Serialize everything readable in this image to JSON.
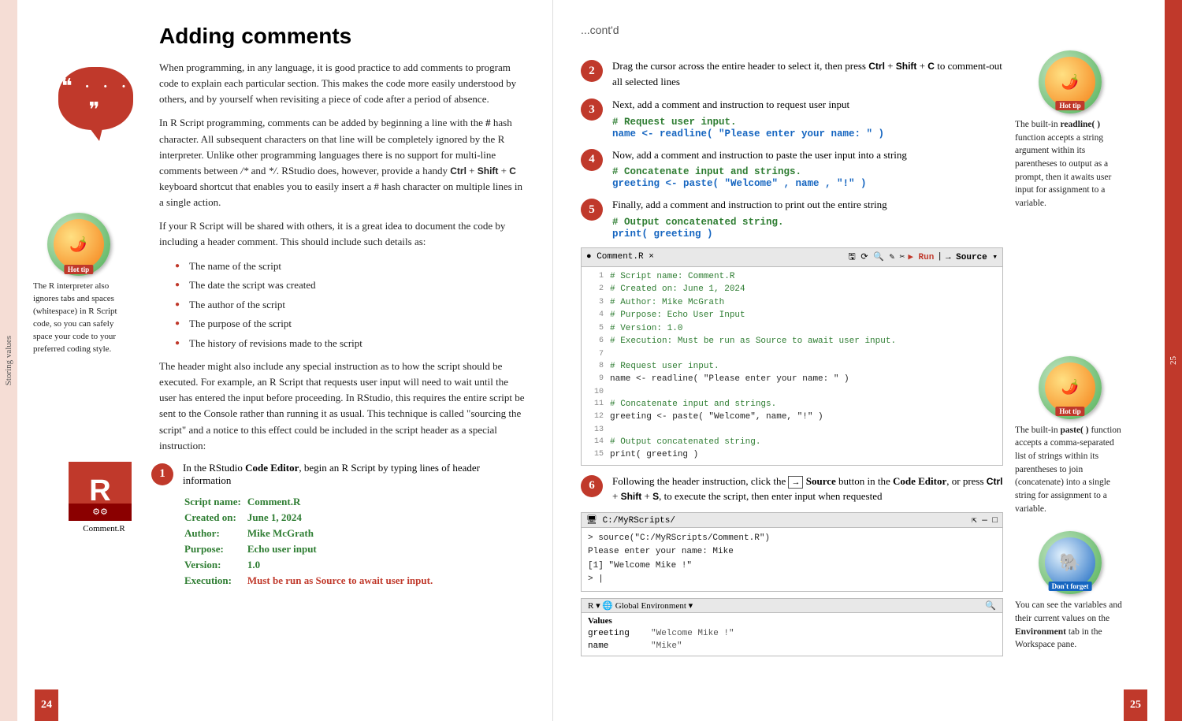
{
  "left_tab": {
    "label": "Storing values"
  },
  "right_tab": {
    "label": "25"
  },
  "page_number_left": "24",
  "page_number_right": "25",
  "left_page": {
    "title": "Adding comments",
    "paragraphs": [
      "When programming, in any language, it is good practice to add comments to program code to explain each particular section. This makes the code more easily understood by others, and by yourself when revisiting a piece of code after a period of absence.",
      "In R Script programming, comments can be added by beginning a line with the # hash character. All subsequent characters on that line will be completely ignored by the R interpreter. Unlike other programming languages there is no support for multi-line comments between /* and */. RStudio does, however, provide a handy Ctrl + Shift + C keyboard shortcut that enables you to easily insert a # hash character on multiple lines in a single action.",
      "If your R Script will be shared with others, it is a great idea to document the code by including a header comment. This should include such details as:"
    ],
    "bullet_items": [
      "The name of the script",
      "The date the script was created",
      "The author of the script",
      "The purpose of the script",
      "The history of revisions made to the script"
    ],
    "paragraph_after_bullets": "The header might also include any special instruction as to how the script should be executed. For example, an R Script that requests user input will need to wait until the user has entered the input before proceeding. In RStudio, this requires the entire script be sent to the Console rather than running it as usual. This technique is called \"sourcing the script\" and a notice to this effect could be included in the script header as a special instruction:",
    "hot_tip_top": {
      "text": "The R interpreter also ignores tabs and spaces (whitespace) in R Script code, so you can safely space your code to your preferred coding style."
    },
    "step1": {
      "number": "1",
      "intro": "In the RStudio Code Editor, begin an R Script by typing lines of header information",
      "script_name_label": "Script name:",
      "script_name_value": "Comment.R",
      "created_label": "Created on:",
      "created_value": "June 1, 2024",
      "author_label": "Author:",
      "author_value": "Mike McGrath",
      "purpose_label": "Purpose:",
      "purpose_value": "Echo user input",
      "version_label": "Version:",
      "version_value": "1.0",
      "execution_label": "Execution:",
      "execution_value": "Must be run as Source to await user input.",
      "r_icon_label": "Comment.R"
    }
  },
  "right_page": {
    "cont_label": "...cont'd",
    "hot_tip1": {
      "label": "Hot tip",
      "text1": "The built-in",
      "bold1": "readline( )",
      "text2": "function accepts a string argument within its parentheses to output as a prompt, then it awaits user input for assignment to a variable."
    },
    "hot_tip2": {
      "label": "Hot tip",
      "text1": "The built-in",
      "bold1": "paste( )",
      "text2": "function accepts a comma-separated list of strings within its parentheses to join (concatenate) into a single string for assignment to a variable."
    },
    "dont_forget": {
      "label": "Don't forget",
      "text": "You can see the variables and their current values on the Environment tab in the Workspace pane."
    },
    "steps": [
      {
        "number": "2",
        "text": "Drag the cursor across the entire header to select it, then press Ctrl + Shift + C to comment-out all selected lines"
      },
      {
        "number": "3",
        "text": "Next, add a comment and instruction to request user input",
        "code_lines": [
          "# Request user input.",
          "name <- readline( \"Please enter your name: \" )"
        ]
      },
      {
        "number": "4",
        "text": "Now, add a comment and instruction to paste the user input into a string",
        "code_lines": [
          "# Concatenate input and strings.",
          "greeting <- paste( \"Welcome\" , name , \"!\" )"
        ]
      },
      {
        "number": "5",
        "text": "Finally, add a comment and instruction to print out the entire string",
        "code_lines": [
          "# Output concatenated string.",
          "print( greeting )"
        ]
      },
      {
        "number": "6",
        "text_before_bold": "Following the header instruction, click the",
        "bold_text": "Source",
        "text_after": "button in the Code Editor, or press Ctrl + Shift + S, to execute the script, then enter input when requested"
      }
    ],
    "code_editor": {
      "tab": "Comment.R",
      "lines": [
        "# Script name:   Comment.R",
        "# Created on:    June 1, 2024",
        "# Author:        Mike McGrath",
        "# Purpose:       Echo User Input",
        "# Version:       1.0",
        "# Execution:     Must be run as Source to await user input.",
        "",
        "# Request user input.",
        "name <- readline( \"Please enter your name: \" )",
        "",
        "# Concatenate input and strings.",
        "greeting <- paste( \"Welcome\", name, \"!\" )",
        "",
        "# Output concatenated string.",
        "print( greeting )"
      ]
    },
    "console": {
      "title": "C:/MyRScripts/",
      "lines": [
        "> source(\"C:/MyRScripts/Comment.R\")",
        "Please enter your name: Mike",
        "[1] \"Welcome Mike !\"",
        "> |"
      ]
    },
    "environment": {
      "title": "Global Environment",
      "section": "Values",
      "rows": [
        {
          "key": "greeting",
          "value": "\"Welcome Mike !\""
        },
        {
          "key": "name",
          "value": "\"Mike\""
        }
      ]
    }
  }
}
